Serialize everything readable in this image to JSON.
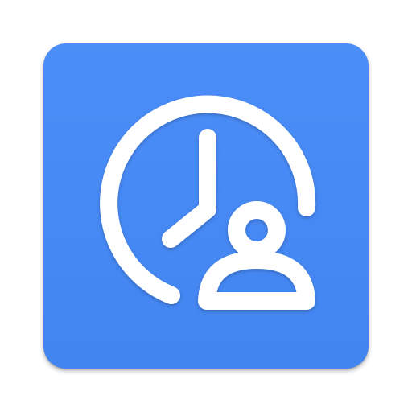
{
  "icon": {
    "name": "clock-with-user-icon",
    "background_color": "#4489f8",
    "foreground_color": "#ffffff"
  }
}
